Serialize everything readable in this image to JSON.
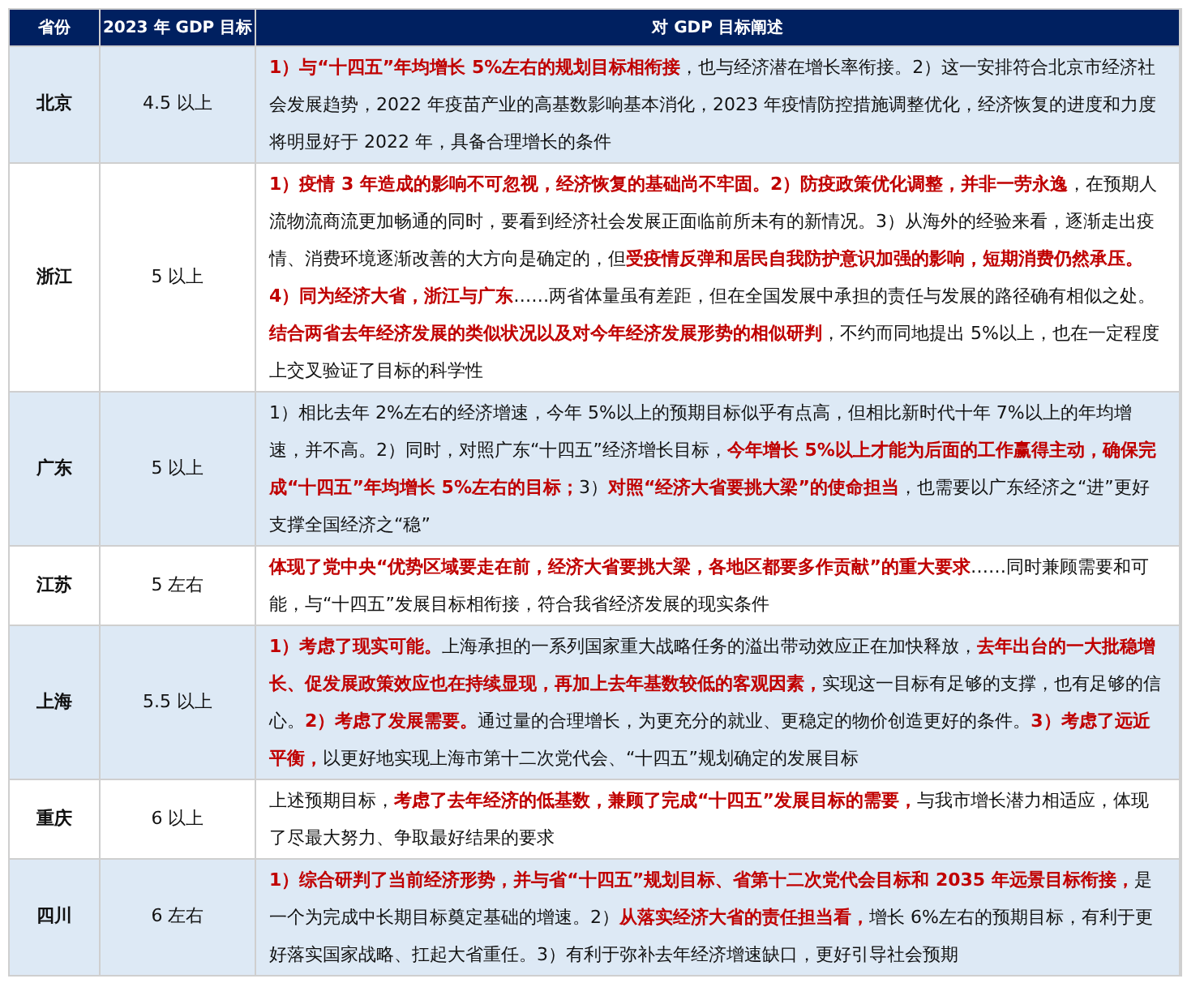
{
  "table": {
    "columns": [
      "省份",
      "2023 年 GDP 目标",
      "对 GDP 目标阐述"
    ],
    "rows": [
      {
        "province": "北京",
        "target": "4.5 以上",
        "description": "**1）与“十四五”年均增长 5%左右的规划目标相衔接**，也与经济潜在增长率衔接。2）这一安排符合北京市经济社会发展趋势，2022 年疫苗产业的高基数影响基本消化，2023 年疫情防控措施调整优化，经济恢复的进度和力度将明显好于 2022 年，具备合理增长的条件"
      },
      {
        "province": "浙江",
        "target": "5 以上",
        "description": "**1）疫情 3 年造成的影响不可忽视，经济恢复的基础尚不牢固。2）防疫政策优化调整，并非一劳永逸**，在预期人流物流商流更加畅通的同时，要看到经济社会发展正面临前所未有的新情况。3）从海外的经验来看，逐渐走出疫情、消费环境逐渐改善的大方向是确定的，但**受疫情反弹和居民自我防护意识加强的影响，短期消费仍然承压。4）同为经济大省，浙江与广东**……两省体量虽有差距，但在全国发展中承担的责任与发展的路径确有相似之处。**结合两省去年经济发展的类似状况以及对今年经济发展形势的相似研判**，不约而同地提出 5%以上，也在一定程度上交叉验证了目标的科学性"
      },
      {
        "province": "广东",
        "target": "5 以上",
        "description": "1）相比去年 2%左右的经济增速，今年 5%以上的预期目标似乎有点高，但相比新时代十年 7%以上的年均增速，并不高。2）同时，对照广东“十四五”经济增长目标，**今年增长 5%以上才能为后面的工作赢得主动，确保完成“十四五”年均增长 5%左右的目标；**3）**对照“经济大省要挑大梁”的使命担当**，也需要以广东经济之“进”更好支撑全国经济之“稳”"
      },
      {
        "province": "江苏",
        "target": "5 左右",
        "description": "**体现了党中央“优势区域要走在前，经济大省要挑大梁，各地区都要多作贡献”的重大要求**……同时兼顾需要和可能，与“十四五”发展目标相衔接，符合我省经济发展的现实条件"
      },
      {
        "province": "上海",
        "target": "5.5 以上",
        "description": "**1）考虑了现实可能。**上海承担的一系列国家重大战略任务的溢出带动效应正在加快释放，**去年出台的一大批稳增长、促发展政策效应也在持续显现，再加上去年基数较低的客观因素，**实现这一目标有足够的支撑，也有足够的信心。**2）考虑了发展需要。**通过量的合理增长，为更充分的就业、更稳定的物价创造更好的条件。**3）考虑了远近平衡，**以更好地实现上海市第十二次党代会、“十四五”规划确定的发展目标"
      },
      {
        "province": "重庆",
        "target": "6 以上",
        "description": "上述预期目标，**考虑了去年经济的低基数，兼顾了完成“十四五”发展目标的需要，**与我市增长潜力相适应，体现了尽最大努力、争取最好结果的要求"
      },
      {
        "province": "四川",
        "target": "6 左右",
        "description": "**1）综合研判了当前经济形势，并与省“十四五”规划目标、省第十二次党代会目标和 2035 年远景目标衔接，**是一个为完成中长期目标奠定基础的增速。2）**从落实经济大省的责任担当看，**增长 6%左右的预期目标，有利于更好落实国家战略、扛起大省重任。3）有利于弥补去年经济增速缺口，更好引导社会预期"
      }
    ]
  }
}
